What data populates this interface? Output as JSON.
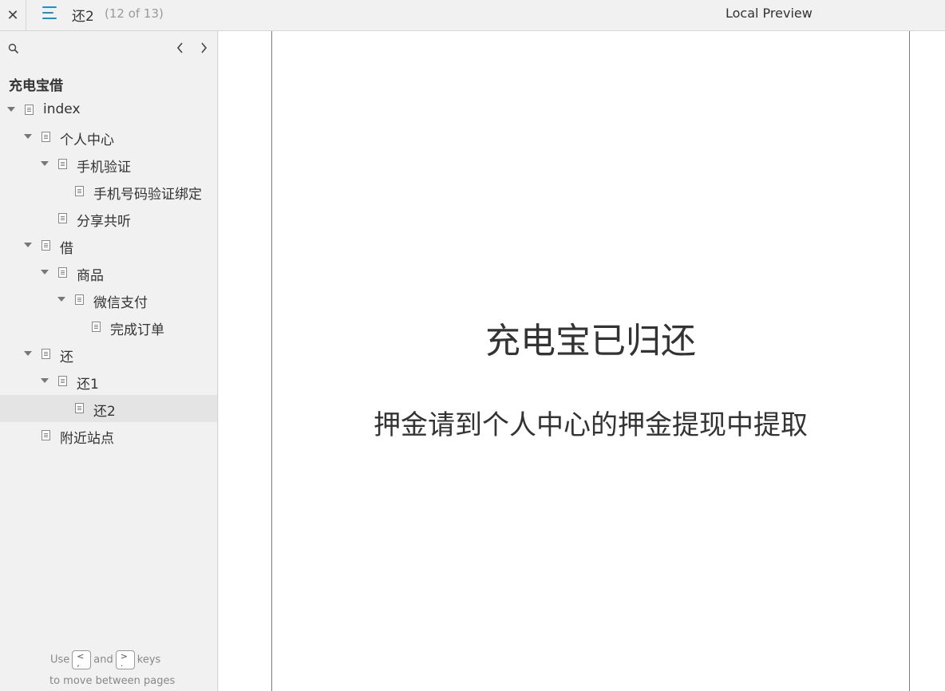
{
  "topbar": {
    "close_glyph": "✕",
    "page_title": "还2",
    "page_count": "(12 of 13)",
    "preview_label": "Local Preview"
  },
  "sidebar": {
    "project_title": "充电宝借",
    "tree": [
      {
        "label": "index",
        "depth": 0,
        "expanded": true,
        "selected": false
      },
      {
        "label": "个人中心",
        "depth": 1,
        "expanded": true,
        "selected": false
      },
      {
        "label": "手机验证",
        "depth": 2,
        "expanded": true,
        "selected": false
      },
      {
        "label": "手机号码验证绑定",
        "depth": 3,
        "expanded": null,
        "selected": false
      },
      {
        "label": "分享共听",
        "depth": 2,
        "expanded": null,
        "selected": false
      },
      {
        "label": "借",
        "depth": 1,
        "expanded": true,
        "selected": false
      },
      {
        "label": "商品",
        "depth": 2,
        "expanded": true,
        "selected": false
      },
      {
        "label": "微信支付",
        "depth": 3,
        "expanded": true,
        "selected": false
      },
      {
        "label": "完成订单",
        "depth": 4,
        "expanded": null,
        "selected": false
      },
      {
        "label": "还",
        "depth": 1,
        "expanded": true,
        "selected": false
      },
      {
        "label": "还1",
        "depth": 2,
        "expanded": true,
        "selected": false
      },
      {
        "label": "还2",
        "depth": 3,
        "expanded": null,
        "selected": true
      },
      {
        "label": "附近站点",
        "depth": 1,
        "expanded": null,
        "selected": false
      }
    ],
    "hint": {
      "use": "Use",
      "prev_key": "<\n,",
      "and": "and",
      "next_key": ">\n.",
      "keys": "keys",
      "line2": "to move between pages"
    }
  },
  "preview": {
    "heading": "充电宝已归还",
    "subtext": "押金请到个人中心的押金提现中提取"
  },
  "colors": {
    "accent": "#1a8fd1",
    "sidebar_bg": "#f1f1f1",
    "selected_bg": "#e4e4e4"
  }
}
